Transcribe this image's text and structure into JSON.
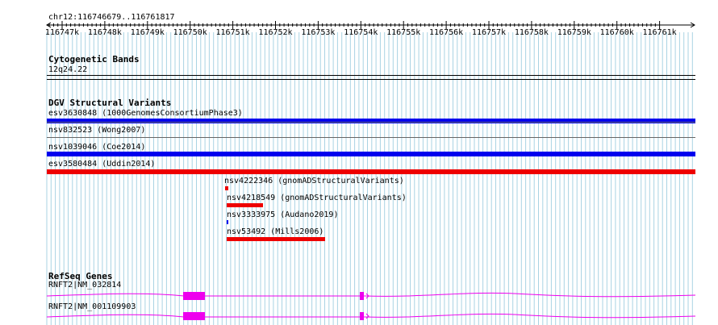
{
  "ruler": {
    "location": "chr12:116746679..116761817",
    "ticks": [
      "116747k",
      "116748k",
      "116749k",
      "116750k",
      "116751k",
      "116752k",
      "116753k",
      "116754k",
      "116755k",
      "116756k",
      "116757k",
      "116758k",
      "116759k",
      "116760k",
      "116761k"
    ]
  },
  "cytoband": {
    "title": "Cytogenetic Bands",
    "band": "12q24.22"
  },
  "dgv": {
    "title": "DGV Structural Variants",
    "variants": [
      {
        "label": "esv3630848 (1000GenomesConsortiumPhase3)",
        "color": "#0000ee"
      },
      {
        "label": "nsv832523 (Wong2007)",
        "color": ""
      },
      {
        "label": "nsv1039046 (Coe2014)",
        "color": "#0000ee"
      },
      {
        "label": "esv3580484 (Uddin2014)",
        "color": "#ee0000"
      },
      {
        "label": "nsv4222346 (gnomADStructuralVariants)",
        "color": "#ee0000"
      },
      {
        "label": "nsv4218549 (gnomADStructuralVariants)",
        "color": "#ee0000"
      },
      {
        "label": "nsv3333975 (Audano2019)",
        "color": "#0000ee"
      },
      {
        "label": "nsv53492 (Mills2006)",
        "color": "#ee0000"
      }
    ]
  },
  "refseq": {
    "title": "RefSeq Genes",
    "color": "#ee00ee",
    "transcripts": [
      {
        "label": "RNFT2|NM_032814"
      },
      {
        "label": "RNFT2|NM_001109903"
      }
    ]
  }
}
